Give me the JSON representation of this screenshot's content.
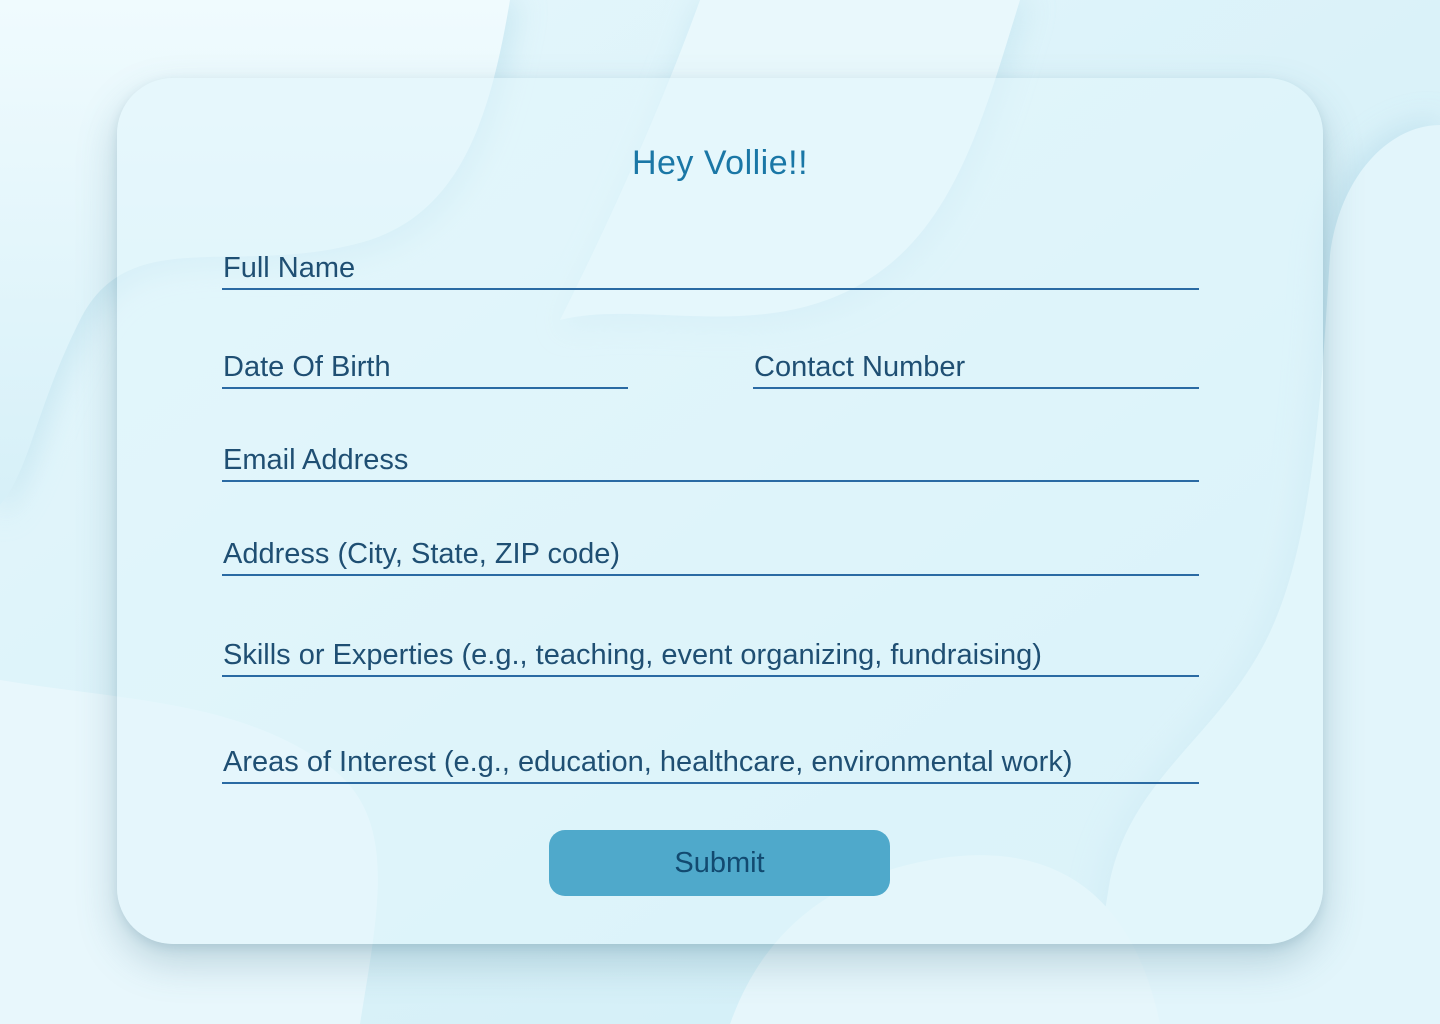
{
  "form": {
    "title": "Hey Vollie!!",
    "fields": {
      "full_name": {
        "placeholder": "Full Name",
        "value": ""
      },
      "date_of_birth": {
        "placeholder": "Date Of Birth",
        "value": ""
      },
      "contact_number": {
        "placeholder": "Contact Number",
        "value": ""
      },
      "email_address": {
        "placeholder": "Email Address",
        "value": ""
      },
      "address": {
        "placeholder": "Address (City, State, ZIP code)",
        "value": ""
      },
      "skills": {
        "placeholder": "Skills or Experties (e.g., teaching, event organizing, fundraising)",
        "value": ""
      },
      "interests": {
        "placeholder": "Areas of Interest (e.g., education, healthcare, environmental work)",
        "value": ""
      }
    },
    "submit_label": "Submit"
  },
  "colors": {
    "background": "#d8f1f8",
    "title": "#1a77a6",
    "field_text": "#1f4f73",
    "underline": "#2a6aa3",
    "button": "#4fa9cb",
    "button_text": "#124a70"
  }
}
